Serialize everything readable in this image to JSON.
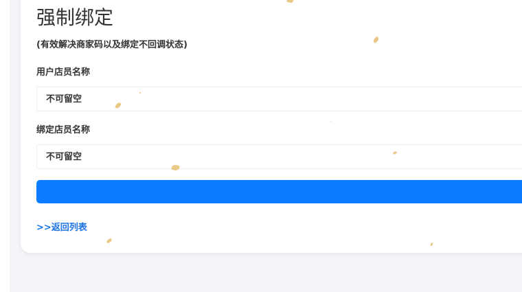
{
  "form": {
    "title": "强制绑定",
    "subtitle": "(有效解决商家码以及绑定不回调状态)",
    "user_store_label": "用户店员名称",
    "user_store_placeholder": "不可留空",
    "bind_store_label": "绑定店员名称",
    "bind_store_placeholder": "不可留空",
    "submit_label": "",
    "back_link": ">>返回列表"
  },
  "colors": {
    "accent": "#0a7cff",
    "link": "#1a73e8",
    "page_background": "#f3f4f8",
    "leaf_decoration": "#e8c27a"
  }
}
